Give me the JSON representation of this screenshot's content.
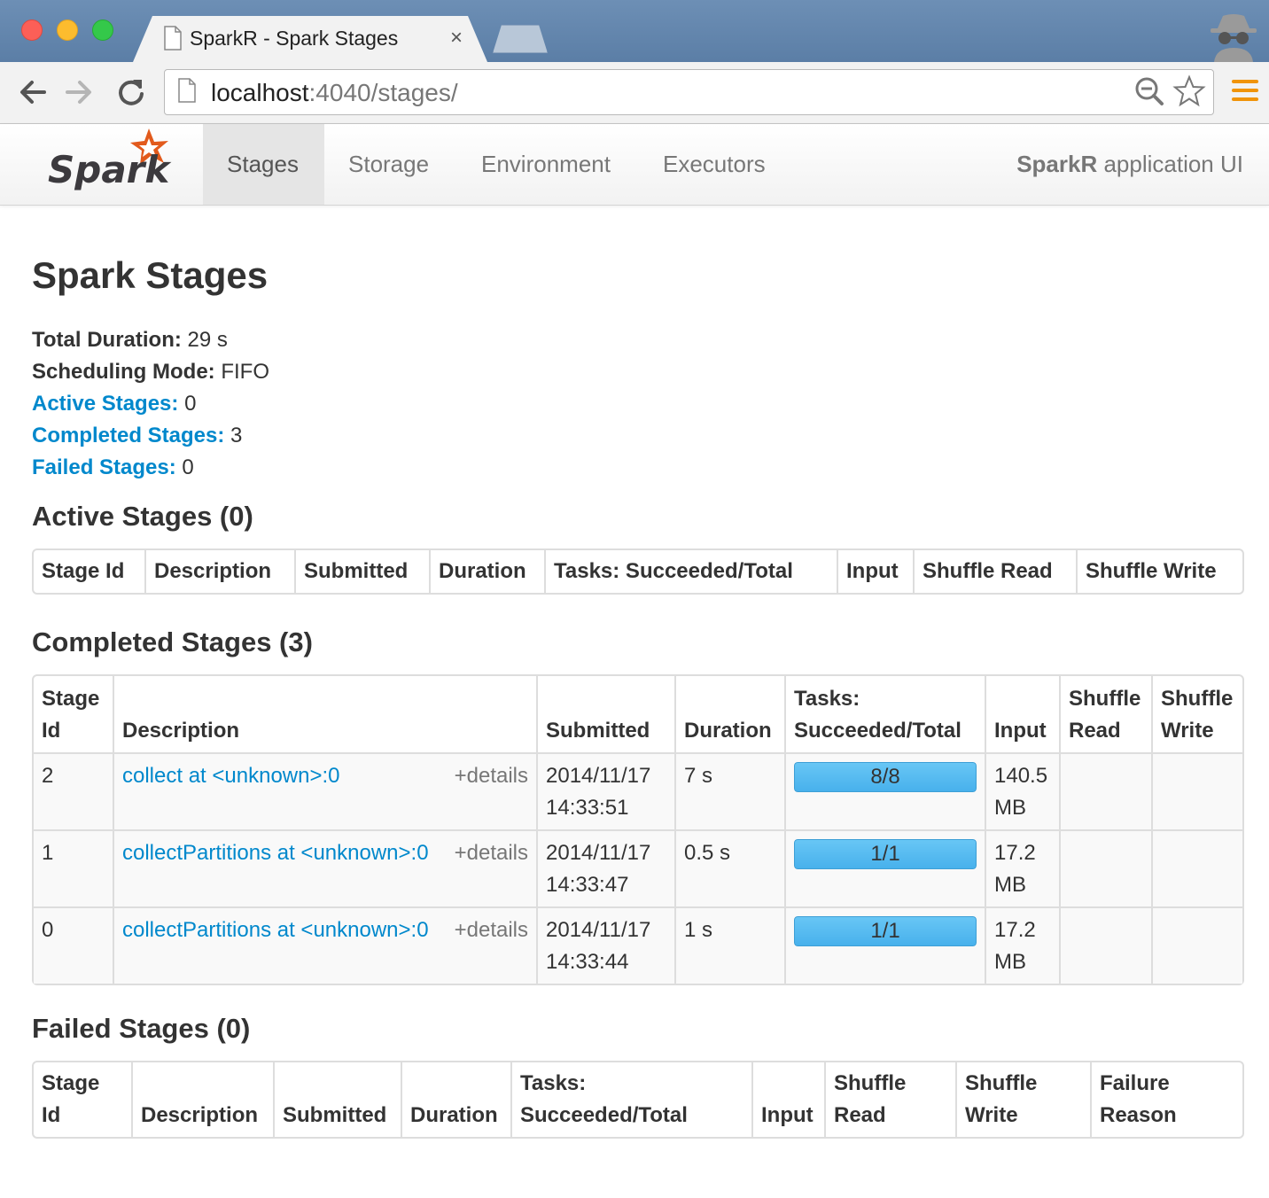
{
  "browser": {
    "tab_title": "SparkR - Spark Stages",
    "tab_close": "×",
    "url_host": "localhost",
    "url_path": ":4040/stages/"
  },
  "navbar": {
    "logo_text": "Spark",
    "items": [
      {
        "label": "Stages",
        "active": true
      },
      {
        "label": "Storage",
        "active": false
      },
      {
        "label": "Environment",
        "active": false
      },
      {
        "label": "Executors",
        "active": false
      }
    ],
    "app_name": "SparkR",
    "app_suffix": " application UI"
  },
  "page": {
    "title": "Spark Stages",
    "summary": {
      "total_duration_label": "Total Duration:",
      "total_duration_value": " 29 s",
      "scheduling_mode_label": "Scheduling Mode:",
      "scheduling_mode_value": " FIFO",
      "active_stages_label": "Active Stages:",
      "active_stages_value": " 0",
      "completed_stages_label": "Completed Stages:",
      "completed_stages_value": " 3",
      "failed_stages_label": "Failed Stages:",
      "failed_stages_value": " 0"
    }
  },
  "active": {
    "heading": "Active Stages (0)",
    "columns": [
      "Stage Id",
      "Description",
      "Submitted",
      "Duration",
      "Tasks: Succeeded/Total",
      "Input",
      "Shuffle Read",
      "Shuffle Write"
    ]
  },
  "completed": {
    "heading": "Completed Stages (3)",
    "columns": [
      "Stage Id",
      "Description",
      "Submitted",
      "Duration",
      "Tasks: Succeeded/Total",
      "Input",
      "Shuffle Read",
      "Shuffle Write"
    ],
    "details_label": "+details",
    "rows": [
      {
        "id": "2",
        "description": "collect at <unknown>:0",
        "submitted_date": "2014/11/17",
        "submitted_time": "14:33:51",
        "duration": "7 s",
        "tasks": "8/8",
        "tasks_fraction": 1.0,
        "input_value": "140.5",
        "input_unit": "MB",
        "shuffle_read": "",
        "shuffle_write": ""
      },
      {
        "id": "1",
        "description": "collectPartitions at <unknown>:0",
        "submitted_date": "2014/11/17",
        "submitted_time": "14:33:47",
        "duration": "0.5 s",
        "tasks": "1/1",
        "tasks_fraction": 1.0,
        "input_value": "17.2",
        "input_unit": "MB",
        "shuffle_read": "",
        "shuffle_write": ""
      },
      {
        "id": "0",
        "description": "collectPartitions at <unknown>:0",
        "submitted_date": "2014/11/17",
        "submitted_time": "14:33:44",
        "duration": "1 s",
        "tasks": "1/1",
        "tasks_fraction": 1.0,
        "input_value": "17.2",
        "input_unit": "MB",
        "shuffle_read": "",
        "shuffle_write": ""
      }
    ]
  },
  "failed": {
    "heading": "Failed Stages (0)",
    "columns": [
      "Stage Id",
      "Description",
      "Submitted",
      "Duration",
      "Tasks: Succeeded/Total",
      "Input",
      "Shuffle Read",
      "Shuffle Write",
      "Failure Reason"
    ]
  },
  "colors": {
    "link": "#0088cc",
    "progress_bar": "#52b7ef",
    "menu_icon": "#f0940a",
    "spark_orange": "#e25a1c"
  }
}
